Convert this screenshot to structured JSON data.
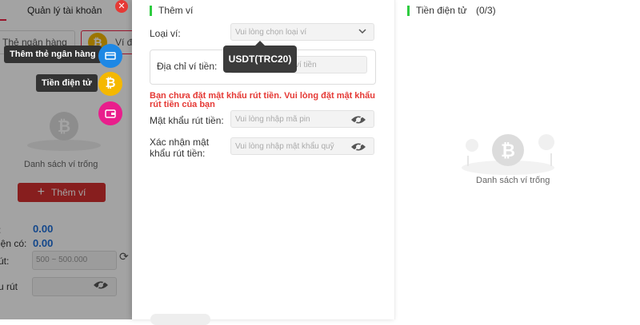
{
  "background": {
    "tabs": {
      "account_label": "Quản lý tài khoản"
    },
    "sub_tabs": {
      "bank_label": "Thẻ ngân hàng",
      "crypto_label": "Ví đ"
    },
    "empty_text": "Danh sách ví trống",
    "add_wallet_label": "Thêm ví",
    "balance_label_1": ":",
    "balance_value_1": "0.00",
    "balance_label_2": "iện có:",
    "balance_value_2": "0.00",
    "amount_label": "út:",
    "amount_placeholder": "500 ~ 500.000",
    "password_label": "u rút"
  },
  "fab_menu": {
    "bank_label": "Thêm thẻ ngân hàng",
    "crypto_label": "Tiền điện tử"
  },
  "form": {
    "title": "Thêm ví",
    "wallet_type_label": "Loại ví:",
    "wallet_type_placeholder": "Vui lòng chọn loại ví",
    "address_label": "Địa chỉ ví tiền:",
    "address_placeholder": "ví tiền",
    "tooltip_text": "USDT(TRC20)",
    "error_text": "Bạn chưa đặt mật khẩu rút tiền. Vui lòng đặt mật khẩu rút tiền của bạn",
    "pin_label": "Mật khẩu rút tiền:",
    "pin_placeholder": "Vui lòng nhập mã pin",
    "confirm_label": "Xác nhận mật khẩu rút tiền:",
    "confirm_placeholder": "Vui lòng nhập mật khẩu quỹ"
  },
  "right_panel": {
    "title": "Tiền điện tử",
    "count": "(0/3)",
    "empty_text": "Danh sách ví trống"
  },
  "colors": {
    "accent_red": "#d32f2f",
    "accent_green": "#2ecc40",
    "link_blue": "#1e6fd9",
    "coin_gold": "#f5b800"
  }
}
